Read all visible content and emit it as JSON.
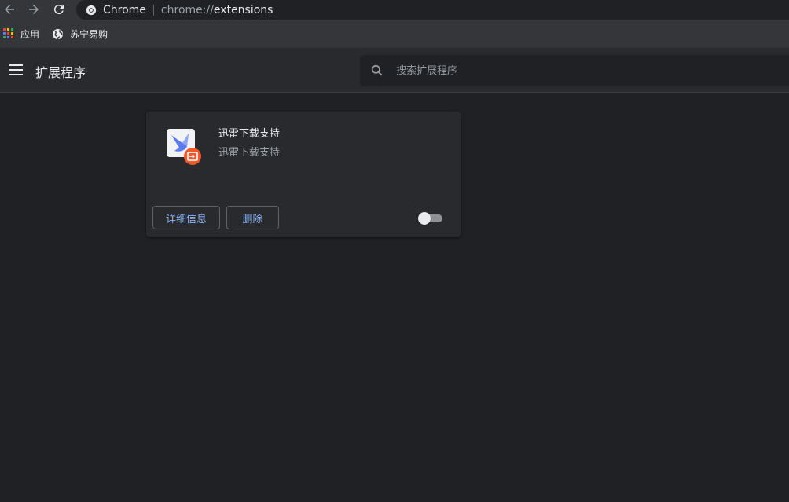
{
  "browser": {
    "omnibox": {
      "chip_label": "Chrome",
      "url_scheme": "chrome://",
      "url_path": "extensions"
    }
  },
  "bookmarks": [
    {
      "label": "应用",
      "icon": "apps-grid-icon"
    },
    {
      "label": "苏宁易购",
      "icon": "globe-icon"
    }
  ],
  "header": {
    "title": "扩展程序",
    "search_placeholder": "搜索扩展程序"
  },
  "extensions": [
    {
      "name": "迅雷下载支持",
      "description": "迅雷下载支持",
      "icon": "xunlei-bird-icon",
      "details_label": "详细信息",
      "remove_label": "删除",
      "enabled": false
    }
  ],
  "colors": {
    "background": "#202124",
    "header": "#292a2d",
    "card": "#292a2d",
    "link_blue": "#8ab4f8",
    "badge_orange": "#f1592a"
  }
}
